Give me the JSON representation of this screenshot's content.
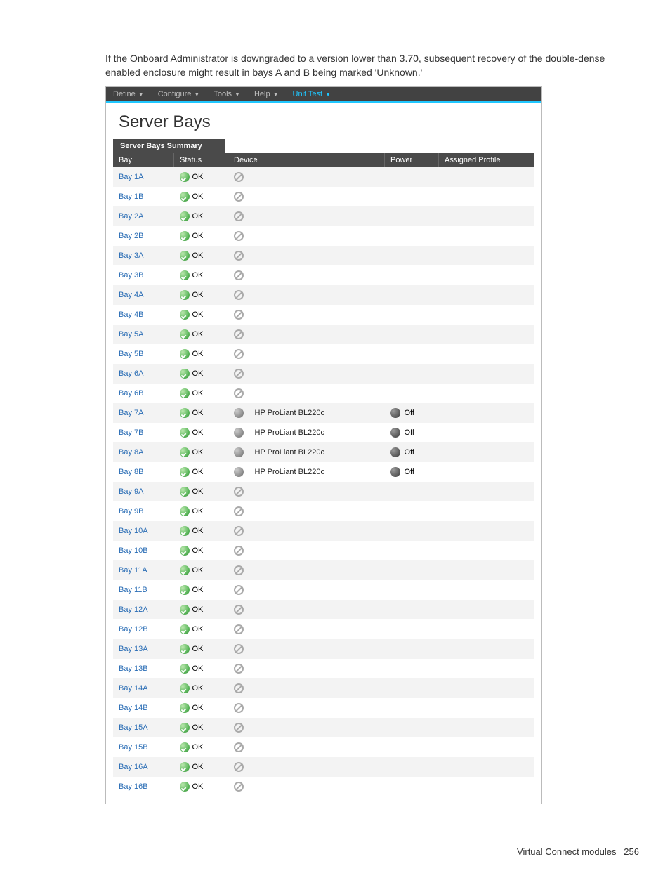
{
  "intro": "If the Onboard Administrator is downgraded to a version lower than 3.70, subsequent recovery of the double-dense enabled enclosure might result in bays A and B being marked 'Unknown.'",
  "menu": {
    "items": [
      {
        "label": "Define",
        "highlight": false
      },
      {
        "label": "Configure",
        "highlight": false
      },
      {
        "label": "Tools",
        "highlight": false
      },
      {
        "label": "Help",
        "highlight": false
      },
      {
        "label": "Unit Test",
        "highlight": true
      }
    ]
  },
  "title": "Server Bays",
  "summary_label": "Server Bays Summary",
  "columns": {
    "bay": "Bay",
    "status": "Status",
    "device": "Device",
    "power": "Power",
    "profile": "Assigned Profile"
  },
  "status_ok": "OK",
  "rows": [
    {
      "bay": "Bay 1A",
      "status": "OK",
      "device": "",
      "device_icon": "empty",
      "power": "",
      "profile": ""
    },
    {
      "bay": "Bay 1B",
      "status": "OK",
      "device": "",
      "device_icon": "empty",
      "power": "",
      "profile": ""
    },
    {
      "bay": "Bay 2A",
      "status": "OK",
      "device": "",
      "device_icon": "empty",
      "power": "",
      "profile": ""
    },
    {
      "bay": "Bay 2B",
      "status": "OK",
      "device": "",
      "device_icon": "empty",
      "power": "",
      "profile": ""
    },
    {
      "bay": "Bay 3A",
      "status": "OK",
      "device": "",
      "device_icon": "empty",
      "power": "",
      "profile": ""
    },
    {
      "bay": "Bay 3B",
      "status": "OK",
      "device": "",
      "device_icon": "empty",
      "power": "",
      "profile": ""
    },
    {
      "bay": "Bay 4A",
      "status": "OK",
      "device": "",
      "device_icon": "empty",
      "power": "",
      "profile": ""
    },
    {
      "bay": "Bay 4B",
      "status": "OK",
      "device": "",
      "device_icon": "empty",
      "power": "",
      "profile": ""
    },
    {
      "bay": "Bay 5A",
      "status": "OK",
      "device": "",
      "device_icon": "empty",
      "power": "",
      "profile": ""
    },
    {
      "bay": "Bay 5B",
      "status": "OK",
      "device": "",
      "device_icon": "empty",
      "power": "",
      "profile": ""
    },
    {
      "bay": "Bay 6A",
      "status": "OK",
      "device": "",
      "device_icon": "empty",
      "power": "",
      "profile": ""
    },
    {
      "bay": "Bay 6B",
      "status": "OK",
      "device": "",
      "device_icon": "empty",
      "power": "",
      "profile": ""
    },
    {
      "bay": "Bay 7A",
      "status": "OK",
      "device": "HP ProLiant BL220c",
      "device_icon": "present",
      "power": "Off",
      "profile": ""
    },
    {
      "bay": "Bay 7B",
      "status": "OK",
      "device": "HP ProLiant BL220c",
      "device_icon": "present",
      "power": "Off",
      "profile": ""
    },
    {
      "bay": "Bay 8A",
      "status": "OK",
      "device": "HP ProLiant BL220c",
      "device_icon": "present",
      "power": "Off",
      "profile": ""
    },
    {
      "bay": "Bay 8B",
      "status": "OK",
      "device": "HP ProLiant BL220c",
      "device_icon": "present",
      "power": "Off",
      "profile": ""
    },
    {
      "bay": "Bay 9A",
      "status": "OK",
      "device": "",
      "device_icon": "empty",
      "power": "",
      "profile": ""
    },
    {
      "bay": "Bay 9B",
      "status": "OK",
      "device": "",
      "device_icon": "empty",
      "power": "",
      "profile": ""
    },
    {
      "bay": "Bay 10A",
      "status": "OK",
      "device": "",
      "device_icon": "empty",
      "power": "",
      "profile": ""
    },
    {
      "bay": "Bay 10B",
      "status": "OK",
      "device": "",
      "device_icon": "empty",
      "power": "",
      "profile": ""
    },
    {
      "bay": "Bay 11A",
      "status": "OK",
      "device": "",
      "device_icon": "empty",
      "power": "",
      "profile": ""
    },
    {
      "bay": "Bay 11B",
      "status": "OK",
      "device": "",
      "device_icon": "empty",
      "power": "",
      "profile": ""
    },
    {
      "bay": "Bay 12A",
      "status": "OK",
      "device": "",
      "device_icon": "empty",
      "power": "",
      "profile": ""
    },
    {
      "bay": "Bay 12B",
      "status": "OK",
      "device": "",
      "device_icon": "empty",
      "power": "",
      "profile": ""
    },
    {
      "bay": "Bay 13A",
      "status": "OK",
      "device": "",
      "device_icon": "empty",
      "power": "",
      "profile": ""
    },
    {
      "bay": "Bay 13B",
      "status": "OK",
      "device": "",
      "device_icon": "empty",
      "power": "",
      "profile": ""
    },
    {
      "bay": "Bay 14A",
      "status": "OK",
      "device": "",
      "device_icon": "empty",
      "power": "",
      "profile": ""
    },
    {
      "bay": "Bay 14B",
      "status": "OK",
      "device": "",
      "device_icon": "empty",
      "power": "",
      "profile": ""
    },
    {
      "bay": "Bay 15A",
      "status": "OK",
      "device": "",
      "device_icon": "empty",
      "power": "",
      "profile": ""
    },
    {
      "bay": "Bay 15B",
      "status": "OK",
      "device": "",
      "device_icon": "empty",
      "power": "",
      "profile": ""
    },
    {
      "bay": "Bay 16A",
      "status": "OK",
      "device": "",
      "device_icon": "empty",
      "power": "",
      "profile": ""
    },
    {
      "bay": "Bay 16B",
      "status": "OK",
      "device": "",
      "device_icon": "empty",
      "power": "",
      "profile": ""
    }
  ],
  "footer": {
    "section": "Virtual Connect modules",
    "page": "256"
  }
}
